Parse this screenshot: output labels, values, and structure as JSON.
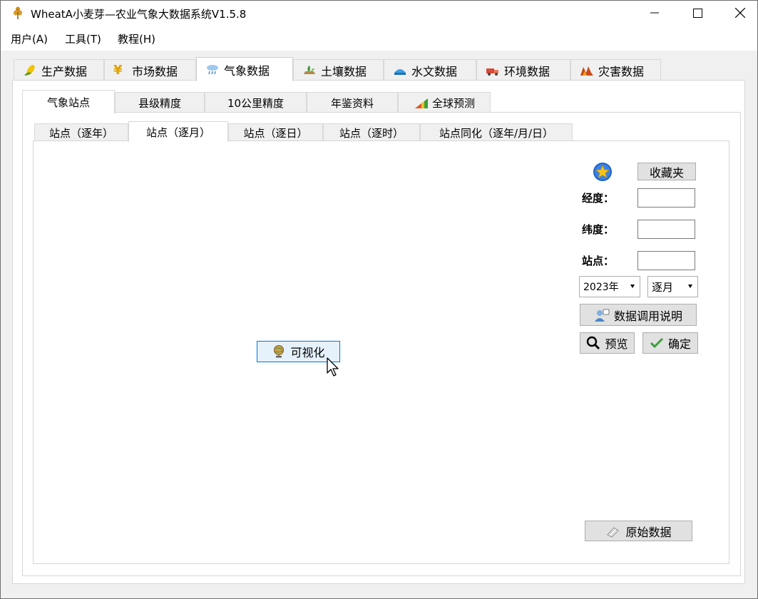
{
  "window": {
    "title": "WheatA小麦芽—农业气象大数据系统V1.5.8"
  },
  "menu": [
    {
      "label": "用户(A)"
    },
    {
      "label": "工具(T)"
    },
    {
      "label": "教程(H)"
    }
  ],
  "main_tabs": [
    {
      "label": "生产数据",
      "icon": "corn-icon"
    },
    {
      "label": "市场数据",
      "icon": "yen-icon"
    },
    {
      "label": "气象数据",
      "icon": "cloud-rain-icon"
    },
    {
      "label": "土壤数据",
      "icon": "soil-icon"
    },
    {
      "label": "水文数据",
      "icon": "water-icon"
    },
    {
      "label": "环境数据",
      "icon": "truck-icon"
    },
    {
      "label": "灾害数据",
      "icon": "disaster-icon"
    }
  ],
  "active_main_tab": "气象数据",
  "sub_tabs": [
    {
      "label": "气象站点"
    },
    {
      "label": "县级精度"
    },
    {
      "label": "10公里精度"
    },
    {
      "label": "年鉴资料"
    },
    {
      "label": "全球预测",
      "icon": "chart-icon"
    }
  ],
  "active_sub_tab": "气象站点",
  "inner_tabs": [
    {
      "label": "站点（逐年）"
    },
    {
      "label": "站点（逐月）"
    },
    {
      "label": "站点（逐日）"
    },
    {
      "label": "站点（逐时）"
    },
    {
      "label": "站点同化（逐年/月/日）"
    }
  ],
  "active_inner_tab": "站点（逐月）",
  "form": {
    "favorites_label": "收藏夹",
    "longitude_label": "经度：",
    "latitude_label": "纬度：",
    "station_label": "站点：",
    "longitude_value": "",
    "latitude_value": "",
    "station_value": "",
    "year_select": "2023年",
    "period_select": "逐月",
    "data_help_label": "数据调用说明",
    "preview_label": "预览",
    "confirm_label": "确定",
    "raw_data_label": "原始数据"
  },
  "visualize_label": "可视化",
  "colors": {
    "accent": "#0078d7",
    "hover_bg": "#e5f1fb",
    "button_bg": "#e1e1e1",
    "panel_bg": "#f0f0f0"
  }
}
